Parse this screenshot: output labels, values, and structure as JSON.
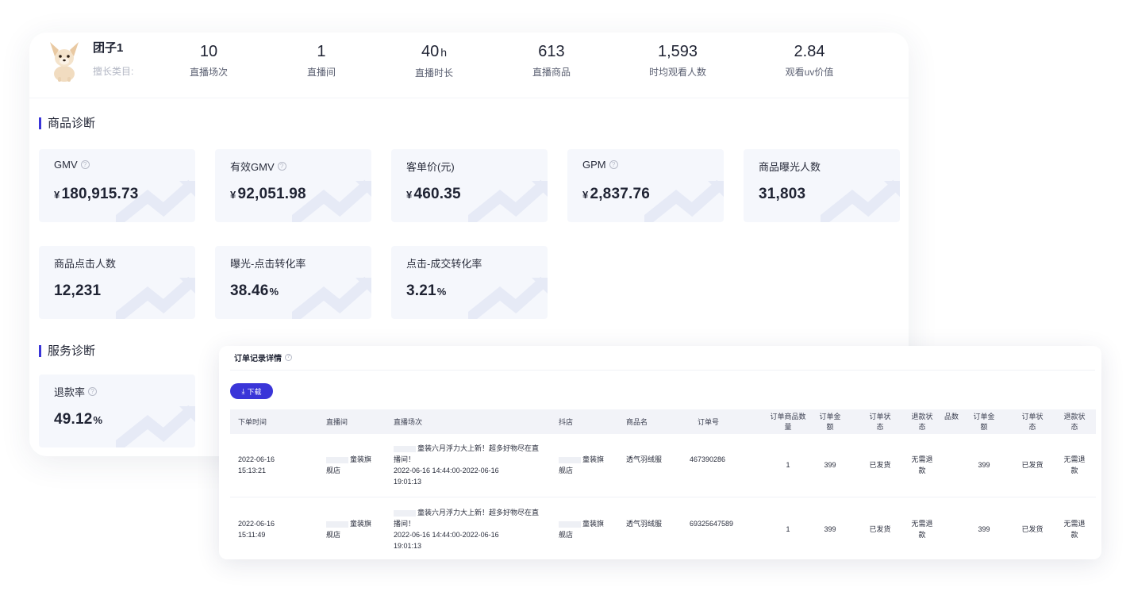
{
  "profile": {
    "name": "团子1",
    "category_label": "擅长类目:",
    "stats": [
      {
        "value": "10",
        "unit": "",
        "label": "直播场次"
      },
      {
        "value": "1",
        "unit": "",
        "label": "直播间"
      },
      {
        "value": "40",
        "unit": "h",
        "label": "直播时长"
      },
      {
        "value": "613",
        "unit": "",
        "label": "直播商品"
      },
      {
        "value": "1,593",
        "unit": "",
        "label": "时均观看人数"
      },
      {
        "value": "2.84",
        "unit": "",
        "label": "观看uv价值"
      }
    ]
  },
  "product_diag": {
    "title": "商品诊断",
    "metrics": [
      {
        "label": "GMV",
        "currency": "¥",
        "value": "180,915.73",
        "suffix": "",
        "help": "?"
      },
      {
        "label": "有效GMV",
        "currency": "¥",
        "value": "92,051.98",
        "suffix": "",
        "help": "?"
      },
      {
        "label": "客单价(元)",
        "currency": "¥",
        "value": "460.35",
        "suffix": "",
        "help": ""
      },
      {
        "label": "GPM",
        "currency": "¥",
        "value": "2,837.76",
        "suffix": "",
        "help": "?"
      },
      {
        "label": "商品曝光人数",
        "currency": "",
        "value": "31,803",
        "suffix": "",
        "help": ""
      },
      {
        "label": "商品点击人数",
        "currency": "",
        "value": "12,231",
        "suffix": "",
        "help": ""
      },
      {
        "label": "曝光-点击转化率",
        "currency": "",
        "value": "38.46",
        "suffix": "%",
        "help": ""
      },
      {
        "label": "点击-成交转化率",
        "currency": "",
        "value": "3.21",
        "suffix": "%",
        "help": ""
      }
    ]
  },
  "service_diag": {
    "title": "服务诊断",
    "metrics": [
      {
        "label": "退款率",
        "value": "49.12",
        "suffix": "%",
        "help": "?"
      }
    ]
  },
  "orders": {
    "title": "订单记录详情",
    "help": "?",
    "download": {
      "icon": "⤓",
      "label": "下载"
    },
    "columns": [
      "下单时间",
      "直播间",
      "直播场次",
      "抖店",
      "商品名",
      "订单号",
      "订单商品数量",
      "订单金额",
      "订单状态",
      "退款状态",
      "品数",
      "订单金额",
      "订单状态",
      "退款状态"
    ],
    "rows": [
      {
        "time1": "2022-06-16",
        "time2": "15:13:21",
        "room1": "童装旗",
        "room2": "舰店",
        "session1": "童装六月浮力大上新！超多好物尽在直",
        "session2": "播间！",
        "session3": "2022-06-16 14:44:00-2022-06-16",
        "session4": "19:01:13",
        "shop1": "童装旗",
        "shop2": "舰店",
        "product": "透气羽绒服",
        "order_no": "467390286",
        "qty": "1",
        "amount": "399",
        "status": "已发货",
        "refund1": "无需退",
        "refund2": "款",
        "amount2": "399",
        "status2": "已发货",
        "refund3": "无需退",
        "refund4": "款"
      },
      {
        "time1": "2022-06-16",
        "time2": "15:11:49",
        "room1": "童装旗",
        "room2": "舰店",
        "session1": "童装六月浮力大上新！超多好物尽在直",
        "session2": "播间！",
        "session3": "2022-06-16 14:44:00-2022-06-16",
        "session4": "19:01:13",
        "shop1": "童装旗",
        "shop2": "舰店",
        "product": "透气羽绒服",
        "order_no": "69325647589",
        "qty": "1",
        "amount": "399",
        "status": "已发货",
        "refund1": "无需退",
        "refund2": "款",
        "amount2": "399",
        "status2": "已发货",
        "refund3": "无需退",
        "refund4": "款"
      }
    ]
  },
  "colors": {
    "accent": "#3a35d8",
    "card_bg": "#f5f7fc"
  }
}
